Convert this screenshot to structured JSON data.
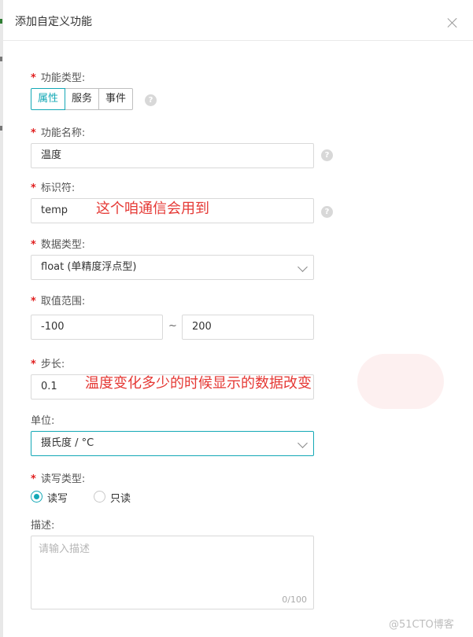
{
  "dialog": {
    "title": "添加自定义功能"
  },
  "form": {
    "function_type": {
      "label": "功能类型:",
      "options": [
        "属性",
        "服务",
        "事件"
      ],
      "selected": "属性"
    },
    "function_name": {
      "label": "功能名称:",
      "value": "温度"
    },
    "identifier": {
      "label": "标识符:",
      "value": "temp"
    },
    "data_type": {
      "label": "数据类型:",
      "value": "float (单精度浮点型)"
    },
    "value_range": {
      "label": "取值范围:",
      "min": "-100",
      "separator": "~",
      "max": "200"
    },
    "step": {
      "label": "步长:",
      "value": "0.1"
    },
    "unit": {
      "label": "单位:",
      "value": "摄氏度 / °C"
    },
    "rw_type": {
      "label": "读写类型:",
      "options": [
        "读写",
        "只读"
      ],
      "selected": "读写"
    },
    "description": {
      "label": "描述:",
      "placeholder": "请输入描述",
      "counter": "0/100"
    }
  },
  "annotations": {
    "identifier_note": "这个咱通信会用到",
    "step_note": "温度变化多少的时候显示的数据改变"
  },
  "watermark": "@51CTO博客",
  "colors": {
    "accent": "#14a8b6",
    "required": "#e02020",
    "annotation": "#e53935"
  },
  "icons": {
    "help": "question-mark-circle",
    "close": "close-x",
    "dropdown": "chevron-down"
  }
}
